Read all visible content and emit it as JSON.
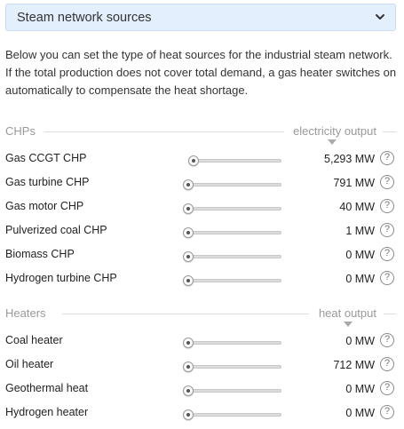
{
  "header": {
    "title": "Steam network sources",
    "icon": "chevron-down-icon"
  },
  "description": "Below you can set the type of heat sources for the industrial steam network. If the total production does not cover total demand, a gas heater switches on automatically to compensate the heat shortage.",
  "groups": [
    {
      "title": "CHPs",
      "column_label": "electricity output",
      "rows": [
        {
          "label": "Gas CCGT CHP",
          "value": "5,293 MW",
          "level": 0.06
        },
        {
          "label": "Gas turbine CHP",
          "value": "791 MW",
          "level": 0
        },
        {
          "label": "Gas motor CHP",
          "value": "40 MW",
          "level": 0
        },
        {
          "label": "Pulverized coal CHP",
          "value": "1 MW",
          "level": 0
        },
        {
          "label": "Biomass CHP",
          "value": "0 MW",
          "level": 0
        },
        {
          "label": "Hydrogen turbine CHP",
          "value": "0 MW",
          "level": 0
        }
      ]
    },
    {
      "title": "Heaters",
      "column_label": "heat output",
      "rows": [
        {
          "label": "Coal heater",
          "value": "0 MW",
          "level": 0
        },
        {
          "label": "Oil heater",
          "value": "712 MW",
          "level": 0
        },
        {
          "label": "Geothermal heat",
          "value": "0 MW",
          "level": 0
        },
        {
          "label": "Hydrogen heater",
          "value": "0 MW",
          "level": 0
        }
      ]
    }
  ],
  "help_glyph": "?"
}
